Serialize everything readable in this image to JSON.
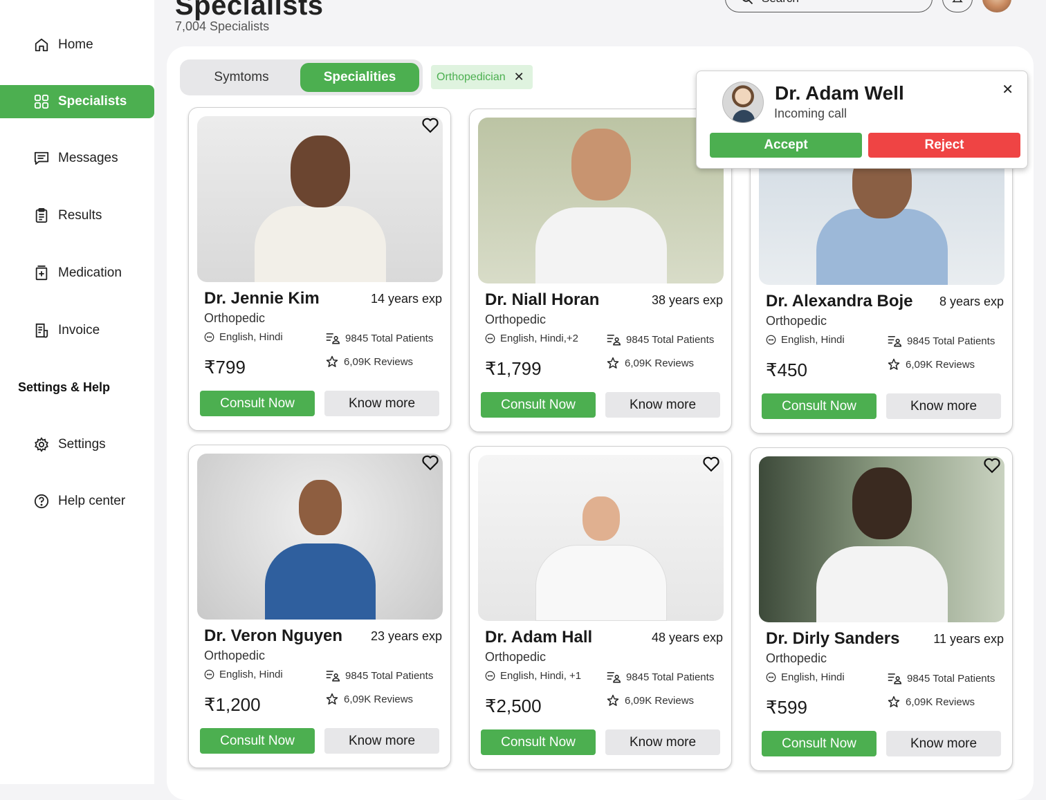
{
  "header": {
    "title": "Specialists",
    "subtitle": "7,004 Specialists",
    "search_label": "Search"
  },
  "sidebar": {
    "items": [
      {
        "label": "Home",
        "icon": "home-icon"
      },
      {
        "label": "Specialists",
        "icon": "grid-icon"
      },
      {
        "label": "Messages",
        "icon": "message-icon"
      },
      {
        "label": "Results",
        "icon": "clipboard-icon"
      },
      {
        "label": "Medication",
        "icon": "medication-icon"
      },
      {
        "label": "Invoice",
        "icon": "invoice-icon"
      }
    ],
    "settings_title": "Settings & Help",
    "settings_items": [
      {
        "label": "Settings",
        "icon": "gear-icon"
      },
      {
        "label": "Help center",
        "icon": "help-icon"
      }
    ]
  },
  "filters": {
    "tabs": [
      {
        "label": "Symtoms"
      },
      {
        "label": "Specialities"
      }
    ],
    "active_tab": "Specialities",
    "chip_label": "Orthopedician"
  },
  "doctors": [
    {
      "name": "Dr. Jennie Kim",
      "exp": "14 years exp",
      "specialty": "Orthopedic",
      "languages": "English, Hindi",
      "patients": "9845 Total Patients",
      "reviews": "6,09K Reviews",
      "price": "₹799",
      "consult": "Consult Now",
      "more": "Know more"
    },
    {
      "name": "Dr. Niall Horan",
      "exp": "38 years exp",
      "specialty": "Orthopedic",
      "languages": "English, Hindi,+2",
      "patients": "9845 Total Patients",
      "reviews": "6,09K Reviews",
      "price": "₹1,799",
      "consult": "Consult Now",
      "more": "Know more"
    },
    {
      "name": "Dr. Alexandra Boje",
      "exp": "8 years exp",
      "specialty": "Orthopedic",
      "languages": "English, Hindi",
      "patients": "9845 Total Patients",
      "reviews": "6,09K Reviews",
      "price": "₹450",
      "consult": "Consult Now",
      "more": "Know more"
    },
    {
      "name": "Dr. Veron Nguyen",
      "exp": "23 years exp",
      "specialty": "Orthopedic",
      "languages": "English, Hindi",
      "patients": "9845 Total Patients",
      "reviews": "6,09K Reviews",
      "price": "₹1,200",
      "consult": "Consult Now",
      "more": "Know more"
    },
    {
      "name": "Dr. Adam Hall",
      "exp": "48 years exp",
      "specialty": "Orthopedic",
      "languages": "English, Hindi, +1",
      "patients": "9845 Total Patients",
      "reviews": "6,09K Reviews",
      "price": "₹2,500",
      "consult": "Consult Now",
      "more": "Know more"
    },
    {
      "name": "Dr. Dirly Sanders",
      "exp": "11 years exp",
      "specialty": "Orthopedic",
      "languages": "English, Hindi",
      "patients": "9845 Total Patients",
      "reviews": "6,09K Reviews",
      "price": "₹599",
      "consult": "Consult Now",
      "more": "Know more"
    }
  ],
  "incoming_call": {
    "name": "Dr. Adam Well",
    "status": "Incoming call",
    "accept": "Accept",
    "reject": "Reject"
  },
  "colors": {
    "accent": "#4caf50",
    "reject": "#ef4444",
    "chip_bg": "#dff3df",
    "panel_bg": "#f4f4f6"
  }
}
